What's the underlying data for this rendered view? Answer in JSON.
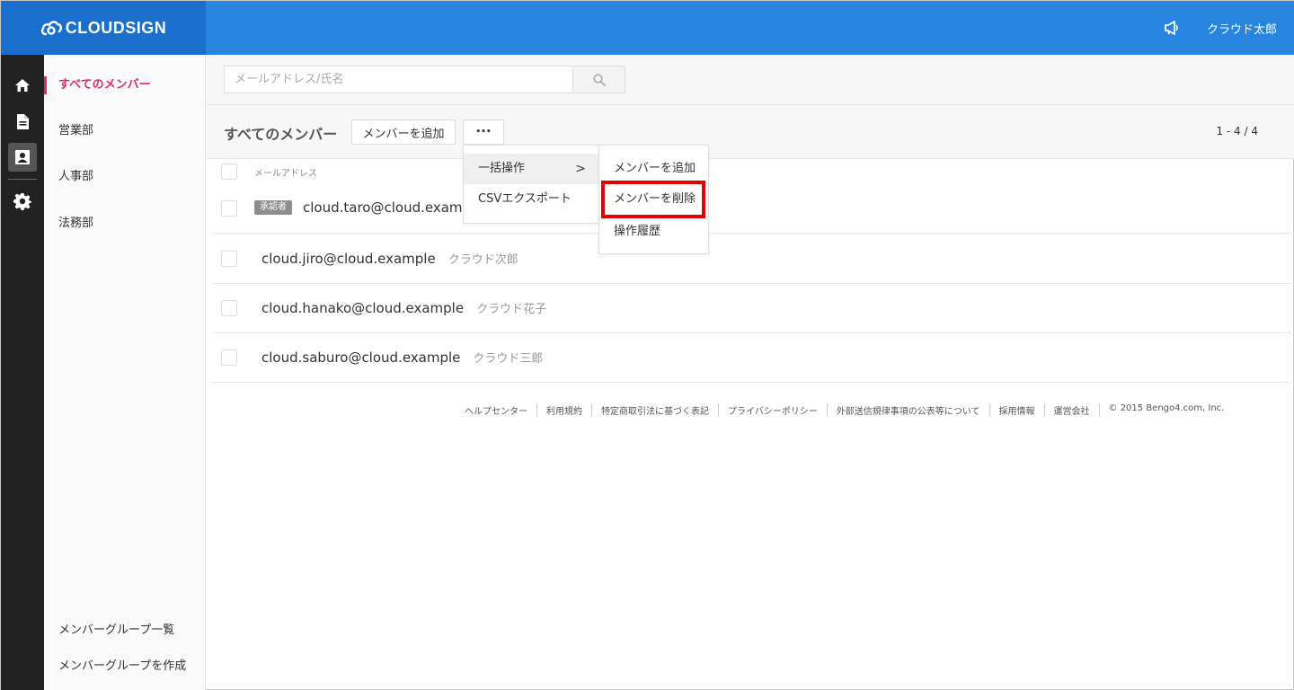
{
  "header": {
    "logo": "CLOUDSIGN",
    "user_name": "クラウド太郎",
    "icons": [
      "cloud-logo-icon",
      "megaphone-icon"
    ],
    "colors": {
      "header_bg": "#2785e0",
      "logo_bg": "#1a6fcc",
      "accent": "#e5295f",
      "highlight": "#e60000"
    }
  },
  "rail": {
    "icons": [
      "home-icon",
      "document-icon",
      "contacts-icon",
      "gear-icon"
    ],
    "active": "contacts-icon"
  },
  "sidebar": {
    "items": [
      {
        "label": "すべてのメンバー"
      },
      {
        "label": "営業部"
      },
      {
        "label": "人事部"
      },
      {
        "label": "法務部"
      }
    ],
    "bottom": [
      {
        "label": "メンバーグループ一覧"
      },
      {
        "label": "メンバーグループを作成"
      }
    ]
  },
  "search": {
    "placeholder": "メールアドレス/氏名",
    "button_icon": "search-icon"
  },
  "toolbar": {
    "title": "すべてのメンバー",
    "add_label": "メンバーを追加",
    "more_label": "•••",
    "pager": "1 - 4 / 4"
  },
  "table": {
    "header_email": "メールアドレス",
    "rows": [
      {
        "badge": "承認者",
        "email": "cloud.taro@cloud.example",
        "name": ""
      },
      {
        "badge": "",
        "email": "cloud.jiro@cloud.example",
        "name": "クラウド次郎"
      },
      {
        "badge": "",
        "email": "cloud.hanako@cloud.example",
        "name": "クラウド花子"
      },
      {
        "badge": "",
        "email": "cloud.saburo@cloud.example",
        "name": "クラウド三郎"
      }
    ]
  },
  "menu": {
    "items": [
      {
        "label": "一括操作",
        "chevron": ">"
      },
      {
        "label": "CSVエクスポート"
      }
    ],
    "submenu": [
      {
        "label": "メンバーを追加"
      },
      {
        "label": "メンバーを削除"
      },
      {
        "label": "操作履歴"
      }
    ]
  },
  "footer": {
    "links": [
      "ヘルプセンター",
      "利用規約",
      "特定商取引法に基づく表記",
      "プライバシーポリシー",
      "外部送信規律事項の公表等について",
      "採用情報",
      "運営会社"
    ],
    "copyright": "© 2015 Bengo4.com, Inc."
  }
}
